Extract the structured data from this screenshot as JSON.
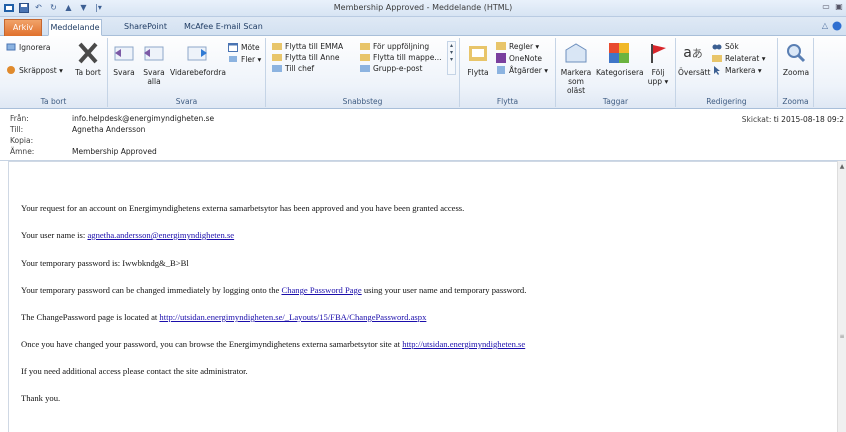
{
  "window": {
    "title": "Membership Approved  -  Meddelande (HTML)"
  },
  "tabs": {
    "file": "Arkiv",
    "message": "Meddelande",
    "sharepoint": "SharePoint",
    "mcafee": "McAfee E-mail Scan"
  },
  "ribbon": {
    "delete": {
      "ignore": "Ignorera",
      "junk": "Skräppost ▾",
      "delete": "Ta bort",
      "group": "Ta bort"
    },
    "respond": {
      "reply": "Svara",
      "reply_all": "Svara alla",
      "forward": "Vidarebefordra",
      "meeting": "Möte",
      "more": "Fler ▾",
      "group": "Svara"
    },
    "quicksteps": {
      "item1": "Flytta till EMMA",
      "item2": "Flytta till Anne",
      "item3": "Till chef",
      "item4": "För uppföljning",
      "item5": "Flytta till mappe...",
      "item6": "Grupp-e-post",
      "group": "Snabbsteg"
    },
    "move": {
      "move": "Flytta",
      "rules": "Regler ▾",
      "onenote": "OneNote",
      "actions": "Åtgärder ▾",
      "group": "Flytta"
    },
    "tags": {
      "mark_unread": "Markera som oläst",
      "categorize": "Kategorisera",
      "follow_up": "Följ upp ▾",
      "group": "Taggar"
    },
    "editing": {
      "translate": "Översätt",
      "find": "Sök",
      "related": "Relaterat ▾",
      "select": "Markera ▾",
      "group": "Redigering"
    },
    "zoom": {
      "zoom": "Zooma",
      "group": "Zooma"
    }
  },
  "header": {
    "from_label": "Från:",
    "from": "info.helpdesk@energimyndigheten.se",
    "to_label": "Till:",
    "to": "Agnetha Andersson",
    "cc_label": "Kopia:",
    "subject_label": "Ämne:",
    "subject": "Membership Approved",
    "sent_label": "Skickat:",
    "sent": "ti 2015-08-18 09:2"
  },
  "body": {
    "p1": "Your request for an account on Energimyndighetens externa samarbetsytor has been approved and you have been granted access.",
    "p2_pre": "Your user name is: ",
    "p2_link": "agnetha.andersson@energimyndigheten.se",
    "p3": "Your temporary password is: Iwwbkndg&_B>Bl",
    "p4_pre": "Your temporary password can be changed immediately by logging onto the ",
    "p4_link": "Change Password Page",
    "p4_post": " using your user name and temporary password.",
    "p5_pre": "The ChangePassword page is located at ",
    "p5_link": "http://utsidan.energimyndigheten.se/_Layouts/15/FBA/ChangePassword.aspx",
    "p6_pre": "Once you have changed your password, you can browse the Energimyndighetens externa samarbetsytor site at ",
    "p6_link": "http://utsidan.energimyndigheten.se",
    "p7": "If you need additional access please contact the site administrator.",
    "p8": "Thank you."
  }
}
